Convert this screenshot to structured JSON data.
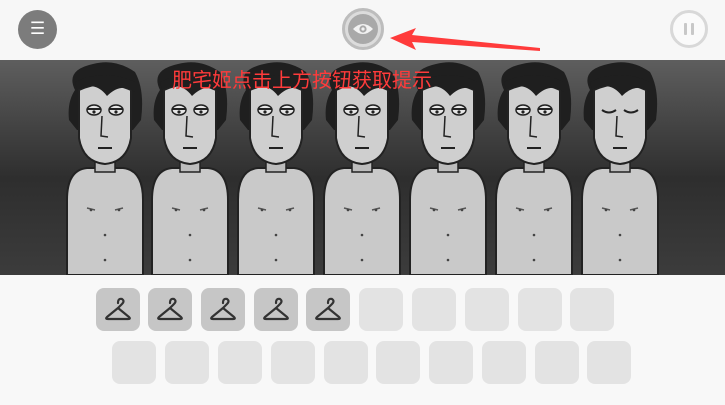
{
  "hud": {
    "menu_icon": "☰",
    "hint_icon": "eye-icon",
    "pause_icon": "pause-icon",
    "hint_text": "肥宅姬点击上方按钮获取提示"
  },
  "characters": {
    "count": 7
  },
  "slots": {
    "row1": [
      {
        "filled": true,
        "icon": "hanger-icon"
      },
      {
        "filled": true,
        "icon": "hanger-icon"
      },
      {
        "filled": true,
        "icon": "hanger-icon"
      },
      {
        "filled": true,
        "icon": "hanger-icon"
      },
      {
        "filled": true,
        "icon": "hanger-icon"
      },
      {
        "filled": false
      },
      {
        "filled": false
      },
      {
        "filled": false
      },
      {
        "filled": false
      },
      {
        "filled": false
      }
    ],
    "row2": [
      {
        "filled": false
      },
      {
        "filled": false
      },
      {
        "filled": false
      },
      {
        "filled": false
      },
      {
        "filled": false
      },
      {
        "filled": false
      },
      {
        "filled": false
      },
      {
        "filled": false
      },
      {
        "filled": false
      },
      {
        "filled": false
      }
    ]
  },
  "colors": {
    "hint_text": "#ff3b3b",
    "slot_empty": "#e3e3e3",
    "slot_filled": "#c6c6c6",
    "stage_top": "#5e5e5e",
    "stage_bottom": "#2e2e2e"
  }
}
